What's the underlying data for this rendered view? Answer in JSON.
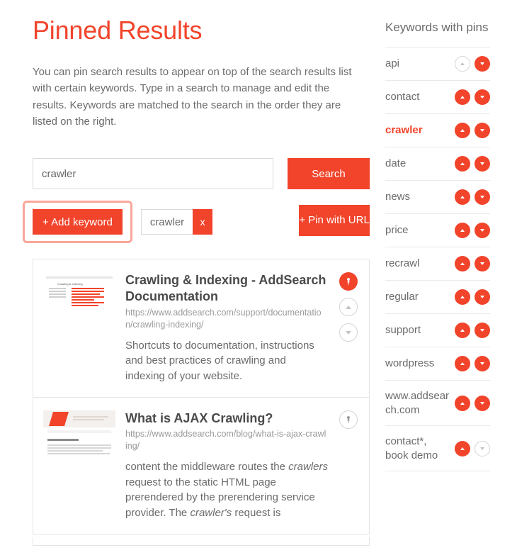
{
  "page": {
    "title": "Pinned Results",
    "intro": "You can pin search results to appear on top of the search results list with certain keywords. Type in a search to manage and edit the results. Keywords are matched to the search in the order they are listed on the right."
  },
  "search": {
    "value": "crawler",
    "button": "Search"
  },
  "toolbar": {
    "add_keyword": "+ Add keyword",
    "pin_url": "+ Pin with URL",
    "chip_label": "crawler",
    "chip_x": "x"
  },
  "results": [
    {
      "title": "Crawling & Indexing - AddSearch Documentation",
      "url": "https://www.addsearch.com/support/documentation/crawling-indexing/",
      "desc": "Shortcuts to documentation, instructions and best practices of crawling and indexing of your website.",
      "pinned": true
    },
    {
      "title": "What is AJAX Crawling?",
      "url": "https://www.addsearch.com/blog/what-is-ajax-crawling/",
      "desc_html": "content the middleware routes the <em>crawlers</em> request to the static HTML page prerendered by the prerendering service provider. The <em>crawler's</em> request is",
      "pinned": false
    }
  ],
  "sidebar": {
    "title": "Keywords with pins",
    "items": [
      {
        "label": "api",
        "up_enabled": false,
        "down_enabled": true,
        "active": false
      },
      {
        "label": "contact",
        "up_enabled": true,
        "down_enabled": true,
        "active": false
      },
      {
        "label": "crawler",
        "up_enabled": true,
        "down_enabled": true,
        "active": true
      },
      {
        "label": "date",
        "up_enabled": true,
        "down_enabled": true,
        "active": false
      },
      {
        "label": "news",
        "up_enabled": true,
        "down_enabled": true,
        "active": false
      },
      {
        "label": "price",
        "up_enabled": true,
        "down_enabled": true,
        "active": false
      },
      {
        "label": "recrawl",
        "up_enabled": true,
        "down_enabled": true,
        "active": false
      },
      {
        "label": "regular",
        "up_enabled": true,
        "down_enabled": true,
        "active": false
      },
      {
        "label": "support",
        "up_enabled": true,
        "down_enabled": true,
        "active": false
      },
      {
        "label": "wordpress",
        "up_enabled": true,
        "down_enabled": true,
        "active": false
      },
      {
        "label": "www.addsearch.com",
        "up_enabled": true,
        "down_enabled": true,
        "active": false
      },
      {
        "label": "contact*, book demo",
        "up_enabled": true,
        "down_enabled": false,
        "active": false
      }
    ]
  },
  "colors": {
    "accent": "#f1442b"
  }
}
